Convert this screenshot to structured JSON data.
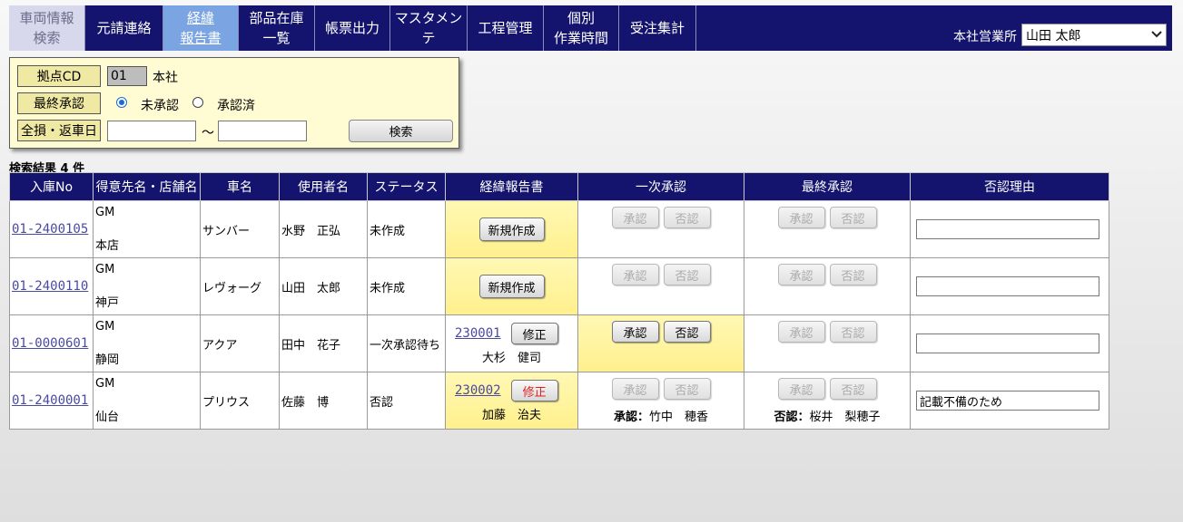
{
  "nav": {
    "items": [
      {
        "line1": "車両情報",
        "line2": "検索",
        "state": "inactive"
      },
      {
        "line1": "元請連絡",
        "line2": "",
        "state": "normal"
      },
      {
        "line1": "経緯",
        "line2": "報告書",
        "state": "active"
      },
      {
        "line1": "部品在庫",
        "line2": "一覧",
        "state": "normal"
      },
      {
        "line1": "帳票出力",
        "line2": "",
        "state": "normal"
      },
      {
        "line1": "マスタメンテ",
        "line2": "",
        "state": "normal"
      },
      {
        "line1": "工程管理",
        "line2": "",
        "state": "normal"
      },
      {
        "line1": "個別",
        "line2": "作業時間",
        "state": "normal"
      },
      {
        "line1": "受注集計",
        "line2": "",
        "state": "normal"
      }
    ],
    "office_label": "本社営業所",
    "user_selected": "山田 太郎"
  },
  "search": {
    "base_cd_label": "拠点CD",
    "base_cd_value": "01",
    "base_name": "本社",
    "final_approval_label": "最終承認",
    "radio_unapproved": "未承認",
    "radio_approved": "承認済",
    "selected_radio": "未承認",
    "date_label": "全損・返車日",
    "date_from": "",
    "date_to": "",
    "tilde": "～",
    "search_button": "検索"
  },
  "results": {
    "count_text": "検索結果 4 件",
    "headers": [
      "入庫No",
      "得意先名・店舗名",
      "車名",
      "使用者名",
      "ステータス",
      "経緯報告書",
      "一次承認",
      "最終承認",
      "否認理由"
    ],
    "approve_label": "承認",
    "reject_label": "否認",
    "rows": [
      {
        "no": "01-2400105",
        "customer": "GM",
        "store": "本店",
        "car": "サンバー",
        "user": "水野　正弘",
        "status": "未作成",
        "report_button": "新規作成",
        "reject_reason": ""
      },
      {
        "no": "01-2400110",
        "customer": "GM",
        "store": "神戸",
        "car": "レヴォーグ",
        "user": "山田　太郎",
        "status": "未作成",
        "report_button": "新規作成",
        "reject_reason": ""
      },
      {
        "no": "01-0000601",
        "customer": "GM",
        "store": "静岡",
        "car": "アクア",
        "user": "田中　花子",
        "status": "一次承認待ち",
        "report_no": "230001",
        "report_button": "修正",
        "report_author": "大杉　健司",
        "reject_reason": ""
      },
      {
        "no": "01-2400001",
        "customer": "GM",
        "store": "仙台",
        "car": "プリウス",
        "user": "佐藤　博",
        "status": "否認",
        "report_no": "230002",
        "report_button": "修正",
        "report_author": "加藤　治夫",
        "first_note_label": "承認：",
        "first_note_name": "竹中　穂香",
        "final_note_label": "否認：",
        "final_note_name": "桜井　梨穂子",
        "reject_reason": "記載不備のため"
      }
    ]
  },
  "colors": {
    "nav_bg": "#14146e",
    "active_tab": "#7aa4e2",
    "panel_bg": "#fffbd3",
    "highlight": "#fff69c",
    "link": "#4a4aa0",
    "danger_text": "#e02020"
  }
}
